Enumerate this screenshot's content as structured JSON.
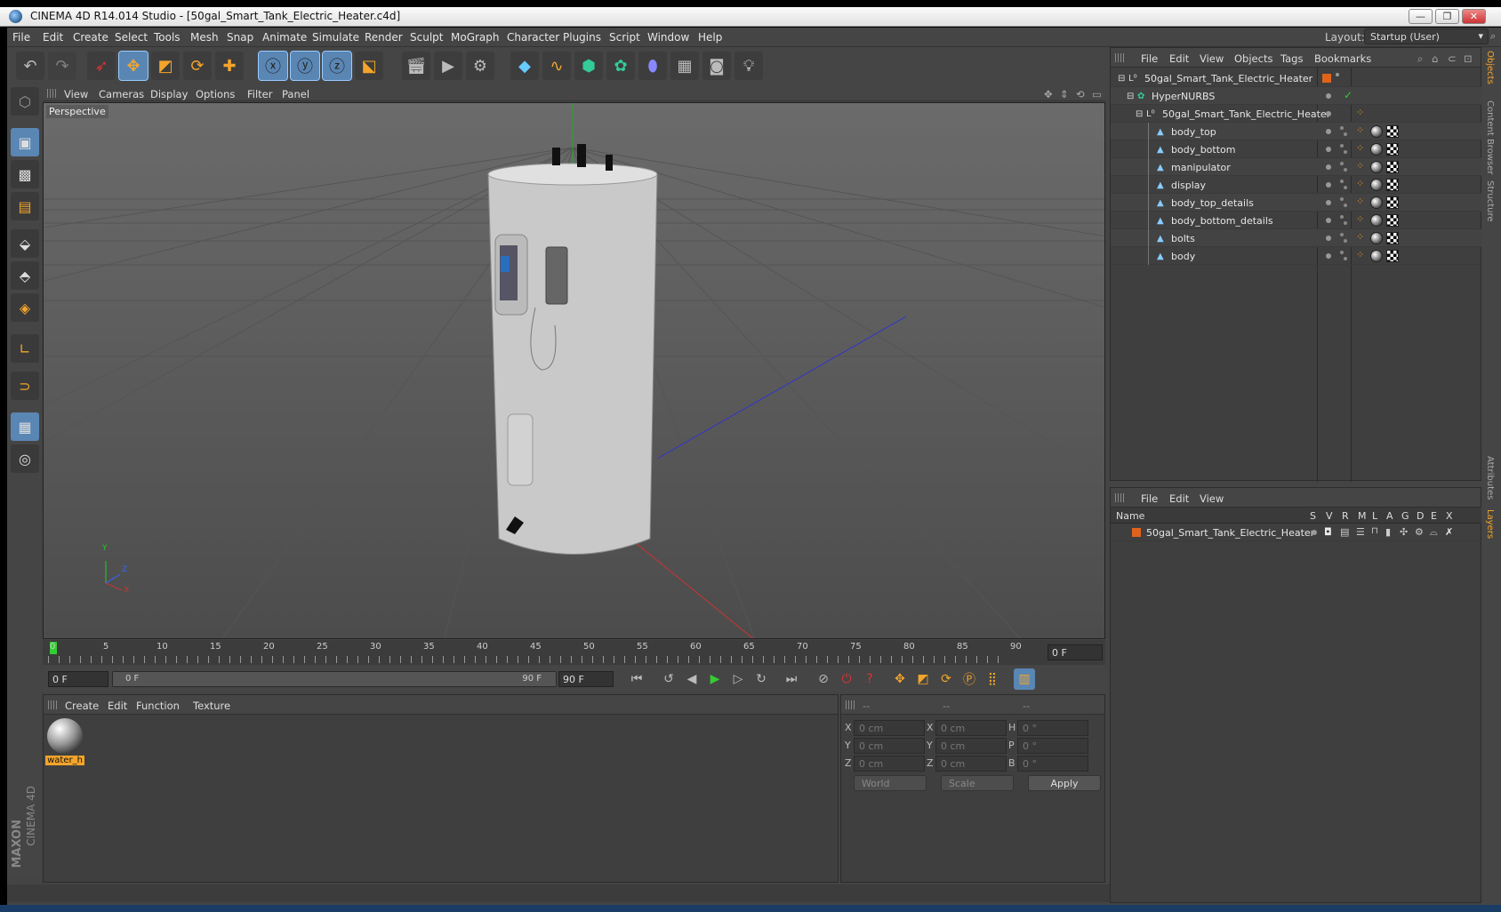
{
  "window": {
    "title": "CINEMA 4D R14.014 Studio - [50gal_Smart_Tank_Electric_Heater.c4d]",
    "minimize": "—",
    "restore": "❐",
    "close": "✕"
  },
  "menubar": {
    "items": [
      "File",
      "Edit",
      "Create",
      "Select",
      "Tools",
      "Mesh",
      "Snap",
      "Animate",
      "Simulate",
      "Render",
      "Sculpt",
      "MoGraph",
      "Character",
      "Plugins",
      "Script",
      "Window",
      "Help"
    ],
    "layout_label": "Layout:",
    "layout_value": "Startup (User)"
  },
  "viewport": {
    "menu": [
      "View",
      "Cameras",
      "Display",
      "Options",
      "Filter",
      "Panel"
    ],
    "label": "Perspective",
    "axis_y": "Y",
    "axis_z": "Z",
    "axis_x": "X"
  },
  "timeline": {
    "ticks": [
      "0",
      "5",
      "10",
      "15",
      "20",
      "25",
      "30",
      "35",
      "40",
      "45",
      "50",
      "55",
      "60",
      "65",
      "70",
      "75",
      "80",
      "85",
      "90"
    ],
    "current_frame": "0 F",
    "start_field": "0 F",
    "range_start": "0 F",
    "range_end": "90 F",
    "end_field": "90 F"
  },
  "material_manager": {
    "menu": [
      "Create",
      "Edit",
      "Function",
      "Texture"
    ],
    "material_name": "water_h"
  },
  "coordinate_manager": {
    "headers": [
      "--",
      "--",
      "--"
    ],
    "rows": [
      {
        "pos_label": "X",
        "pos": "0 cm",
        "size_label": "X",
        "size": "0 cm",
        "rot_label": "H",
        "rot": "0 °"
      },
      {
        "pos_label": "Y",
        "pos": "0 cm",
        "size_label": "Y",
        "size": "0 cm",
        "rot_label": "P",
        "rot": "0 °"
      },
      {
        "pos_label": "Z",
        "pos": "0 cm",
        "size_label": "Z",
        "size": "0 cm",
        "rot_label": "B",
        "rot": "0 °"
      }
    ],
    "space": "World",
    "mode": "Scale",
    "apply": "Apply"
  },
  "object_manager": {
    "menu": [
      "File",
      "Edit",
      "View",
      "Objects",
      "Tags",
      "Bookmarks"
    ],
    "objects": [
      {
        "name": "50gal_Smart_Tank_Electric_Heater",
        "indent": 0
      },
      {
        "name": "HyperNURBS",
        "indent": 1
      },
      {
        "name": "50gal_Smart_Tank_Electric_Heater",
        "indent": 2
      },
      {
        "name": "body_top",
        "indent": 3
      },
      {
        "name": "body_bottom",
        "indent": 3
      },
      {
        "name": "manipulator",
        "indent": 3
      },
      {
        "name": "display",
        "indent": 3
      },
      {
        "name": "body_top_details",
        "indent": 3
      },
      {
        "name": "body_bottom_details",
        "indent": 3
      },
      {
        "name": "bolts",
        "indent": 3
      },
      {
        "name": "body",
        "indent": 3
      }
    ]
  },
  "layer_manager": {
    "menu": [
      "File",
      "Edit",
      "View"
    ],
    "columns": [
      "Name",
      "S",
      "V",
      "R",
      "M",
      "L",
      "A",
      "G",
      "D",
      "E",
      "X"
    ],
    "layer_name": "50gal_Smart_Tank_Electric_Heater"
  },
  "right_tabs": [
    "Objects",
    "Content Browser",
    "Structure",
    "Attributes",
    "Layers"
  ],
  "brand": {
    "line1": "MAXON",
    "line2": "CINEMA 4D"
  },
  "colors": {
    "accent": "#f3a52b",
    "selection": "#5a86b4",
    "layer_color": "#e0631c"
  }
}
